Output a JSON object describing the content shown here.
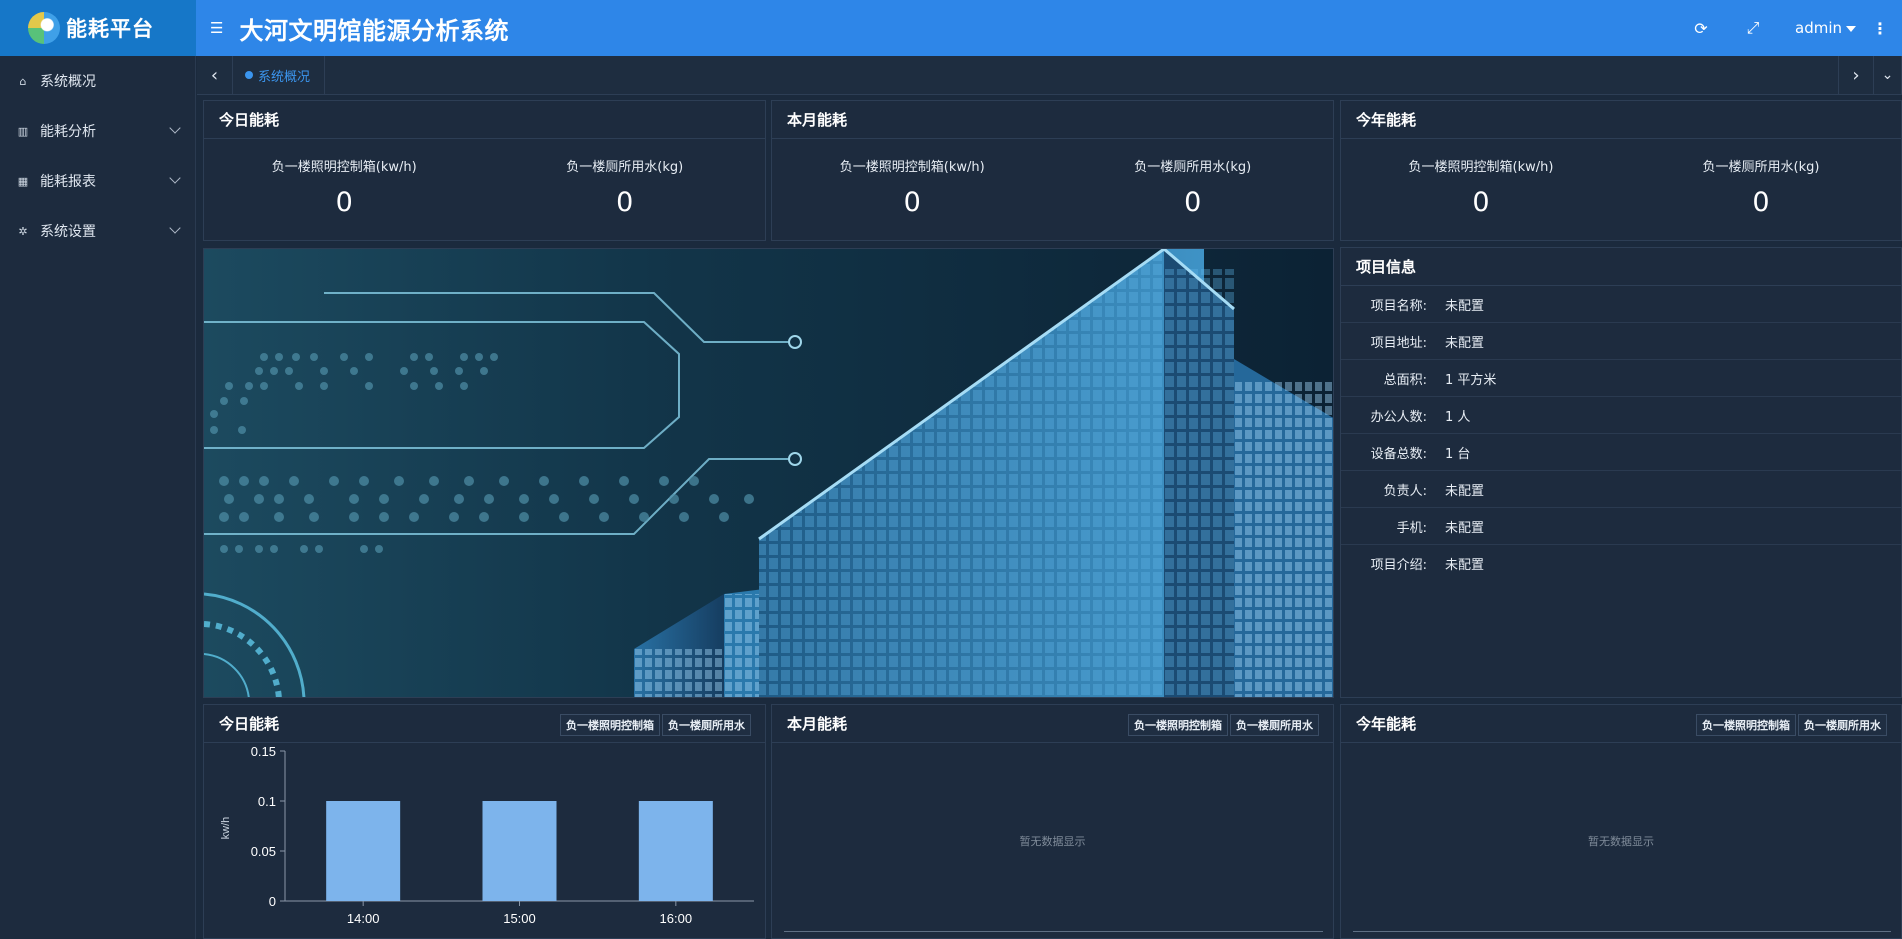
{
  "app": {
    "logo_text": "能耗平台",
    "title": "大河文明馆能源分析系统"
  },
  "header": {
    "user": "admin",
    "icons": [
      "refresh-icon",
      "fullscreen-icon",
      "more-icon"
    ]
  },
  "sidebar": {
    "items": [
      {
        "label": "系统概况",
        "icon": "home-icon",
        "expandable": false
      },
      {
        "label": "能耗分析",
        "icon": "bar-chart-icon",
        "expandable": true
      },
      {
        "label": "能耗报表",
        "icon": "table-icon",
        "expandable": true
      },
      {
        "label": "系统设置",
        "icon": "gear-icon",
        "expandable": true
      }
    ]
  },
  "tabs": {
    "active": "系统概况"
  },
  "summary": [
    {
      "title": "今日能耗",
      "metrics": [
        {
          "label": "负一楼照明控制箱(kw/h)",
          "value": "0"
        },
        {
          "label": "负一楼厕所用水(kg)",
          "value": "0"
        }
      ]
    },
    {
      "title": "本月能耗",
      "metrics": [
        {
          "label": "负一楼照明控制箱(kw/h)",
          "value": "0"
        },
        {
          "label": "负一楼厕所用水(kg)",
          "value": "0"
        }
      ]
    },
    {
      "title": "今年能耗",
      "metrics": [
        {
          "label": "负一楼照明控制箱(kw/h)",
          "value": "0"
        },
        {
          "label": "负一楼厕所用水(kg)",
          "value": "0"
        }
      ]
    }
  ],
  "project": {
    "title": "项目信息",
    "rows": [
      {
        "key": "项目名称:",
        "value": "未配置"
      },
      {
        "key": "项目地址:",
        "value": "未配置"
      },
      {
        "key": "总面积:",
        "value": "1 平方米"
      },
      {
        "key": "办公人数:",
        "value": "1 人"
      },
      {
        "key": "设备总数:",
        "value": "1 台"
      },
      {
        "key": "负责人:",
        "value": "未配置"
      },
      {
        "key": "手机:",
        "value": "未配置"
      },
      {
        "key": "项目介绍:",
        "value": "未配置"
      }
    ]
  },
  "charts": [
    {
      "title": "今日能耗",
      "legend": [
        "负一楼照明控制箱",
        "负一楼厕所用水"
      ],
      "nodata": ""
    },
    {
      "title": "本月能耗",
      "legend": [
        "负一楼照明控制箱",
        "负一楼厕所用水"
      ],
      "nodata": "暂无数据显示"
    },
    {
      "title": "今年能耗",
      "legend": [
        "负一楼照明控制箱",
        "负一楼厕所用水"
      ],
      "nodata": "暂无数据显示"
    }
  ],
  "chart_data": {
    "type": "bar",
    "categories": [
      "14:00",
      "15:00",
      "16:00"
    ],
    "values": [
      0.1,
      0.1,
      0.1
    ],
    "ylabel": "kw/h",
    "ylim": [
      0,
      0.15
    ],
    "yticks": [
      "0",
      "0.05",
      "0.1",
      "0.15"
    ],
    "bar_color": "#7db4ec",
    "grid": false
  },
  "colors": {
    "header": "#2e86e8",
    "logo_bg": "#1677c8",
    "background": "#1b2a3d",
    "accent": "#3b95ee"
  }
}
